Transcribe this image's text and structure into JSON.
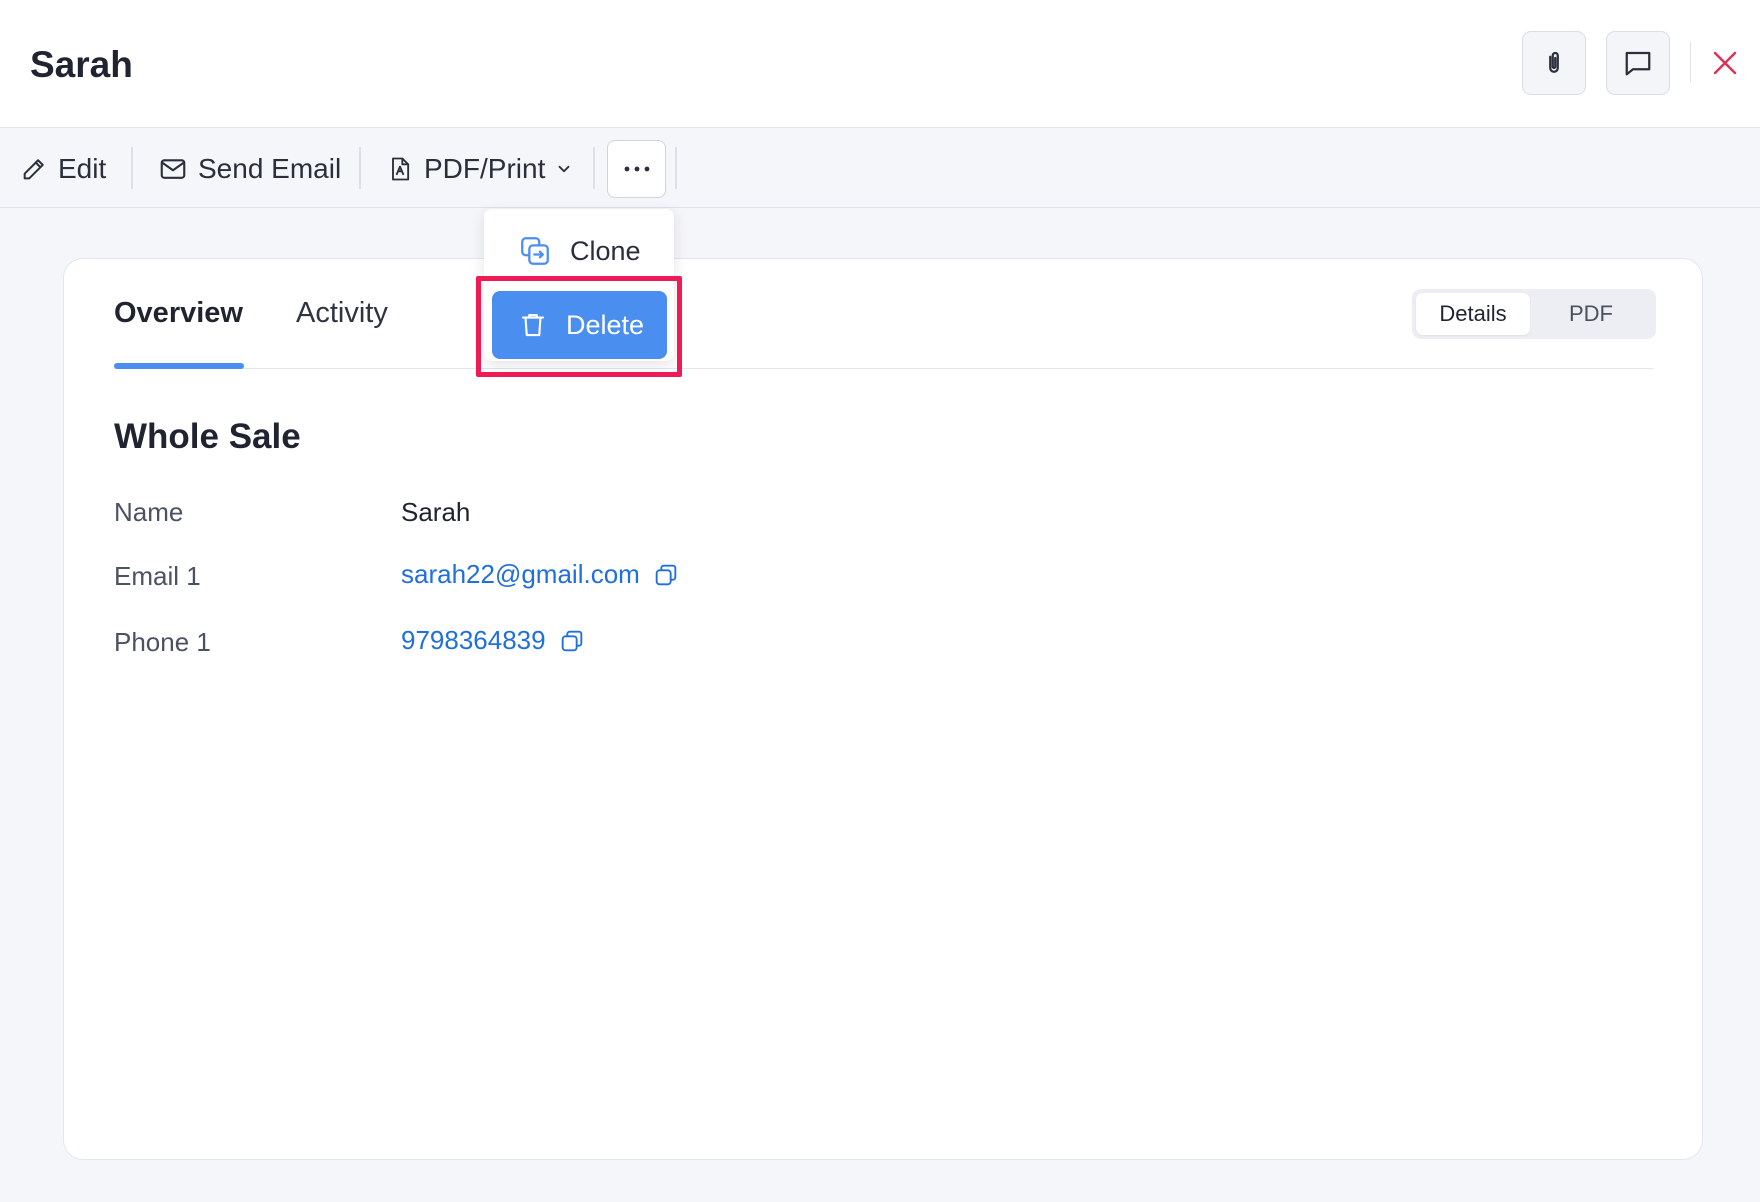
{
  "header": {
    "title": "Sarah",
    "attach_icon": "paperclip-icon",
    "comment_icon": "comment-icon",
    "close_icon": "close-icon",
    "close_color": "#d9345a"
  },
  "toolbar": {
    "edit_label": "Edit",
    "send_email_label": "Send Email",
    "pdf_print_label": "PDF/Print",
    "more_icon": "more-horizontal-icon"
  },
  "dropdown": {
    "items": [
      {
        "label": "Clone",
        "icon": "clone-icon"
      },
      {
        "label": "Delete",
        "icon": "trash-icon",
        "highlighted": true
      }
    ]
  },
  "tabs": {
    "overview": "Overview",
    "activity": "Activity",
    "active": "Overview"
  },
  "view_toggle": {
    "details": "Details",
    "pdf": "PDF",
    "selected": "Details"
  },
  "section": {
    "title": "Whole Sale",
    "fields": {
      "name_label": "Name",
      "name_value": "Sarah",
      "email_label": "Email 1",
      "email_value": "sarah22@gmail.com",
      "phone_label": "Phone 1",
      "phone_value": "9798364839"
    }
  },
  "colors": {
    "accent": "#4a8ef0",
    "link": "#1f6fdc",
    "highlight_border": "#f01a57"
  }
}
